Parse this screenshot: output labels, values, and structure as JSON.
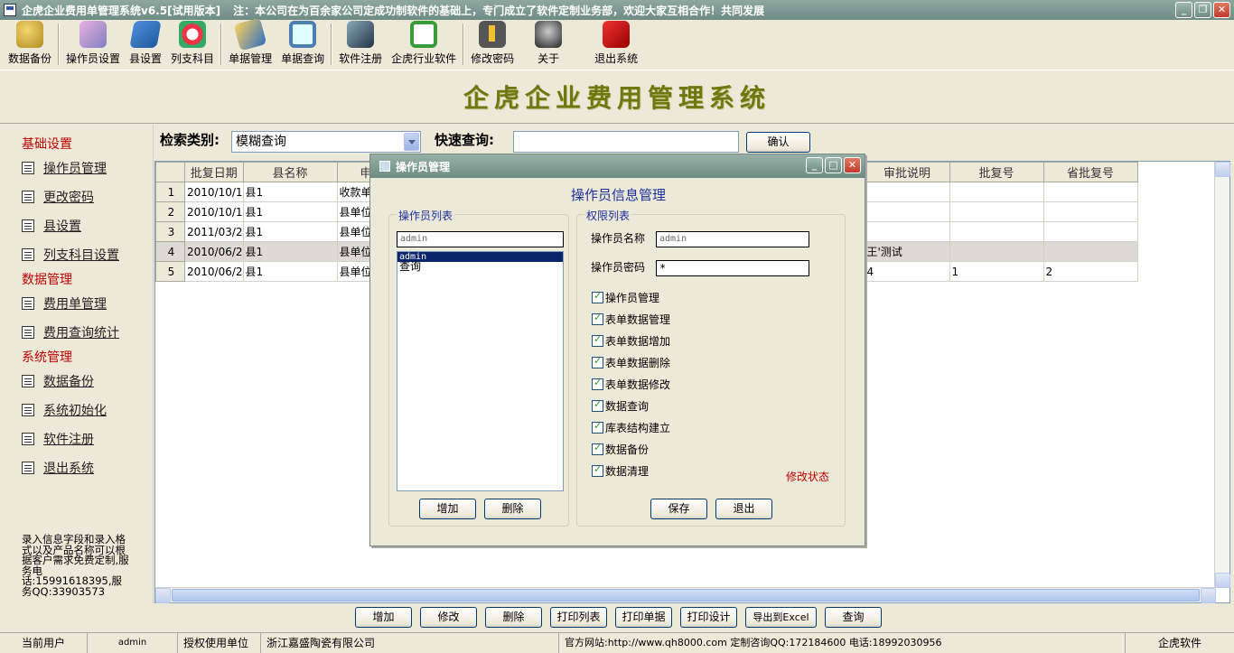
{
  "window": {
    "title": "企虎企业费用单管理系统v6.5[试用版本]",
    "notice": "注：本公司在为百余家公司定成功制软件的基础上，专门成立了软件定制业务部，欢迎大家互相合作！共同发展"
  },
  "toolbar": [
    {
      "label": "数据备份",
      "icon": "database-icon"
    },
    {
      "label": "操作员设置",
      "icon": "user-settings-icon"
    },
    {
      "label": "县设置",
      "icon": "county-icon"
    },
    {
      "label": "列支科目",
      "icon": "subject-icon"
    },
    {
      "label": "单据管理",
      "icon": "document-icon"
    },
    {
      "label": "单据查询",
      "icon": "magnifier-icon"
    },
    {
      "label": "软件注册",
      "icon": "register-icon"
    },
    {
      "label": "企虎行业软件",
      "icon": "refresh-icon"
    },
    {
      "label": "修改密码",
      "icon": "key-icon"
    },
    {
      "label": "关于",
      "icon": "about-icon"
    },
    {
      "label": "退出系统",
      "icon": "exit-icon"
    }
  ],
  "banner": "企虎企业费用管理系统",
  "sidebar": {
    "groups": [
      {
        "title": "基础设置",
        "items": [
          "操作员管理",
          "更改密码",
          "县设置",
          "列支科目设置"
        ]
      },
      {
        "title": "数据管理",
        "items": [
          "费用单管理",
          "费用查询统计"
        ]
      },
      {
        "title": "系统管理",
        "items": [
          "数据备份",
          "系统初始化",
          "软件注册",
          "退出系统"
        ]
      }
    ],
    "promo": "录入信息字段和录入格式以及产品名称可以根据客户需求免费定制,服务电话:15991618395,服务QQ:33903573"
  },
  "search": {
    "category_label": "检索类别:",
    "category_value": "模糊查询",
    "quick_label": "快速查询:",
    "quick_value": "",
    "confirm_label": "确认"
  },
  "grid": {
    "columns_left": [
      "批复日期",
      "县名称",
      "申"
    ],
    "columns_right": [
      "审批说明",
      "批复号",
      "省批复号"
    ],
    "rows": [
      {
        "n": "1",
        "date": "2010/10/1",
        "county": "县1",
        "app": "收款单",
        "note": "",
        "reply": "",
        "prov": ""
      },
      {
        "n": "2",
        "date": "2010/10/1",
        "county": "县1",
        "app": "县单位",
        "note": "",
        "reply": "",
        "prov": ""
      },
      {
        "n": "3",
        "date": "2011/03/2",
        "county": "县1",
        "app": "县单位",
        "note": "",
        "reply": "",
        "prov": ""
      },
      {
        "n": "4",
        "date": "2010/06/2",
        "county": "县1",
        "app": "县单位",
        "note": "王'测试",
        "reply": "",
        "prov": ""
      },
      {
        "n": "5",
        "date": "2010/06/2",
        "county": "县1",
        "app": "县单位",
        "note": "4",
        "reply": "1",
        "prov": "2"
      }
    ],
    "selected_row": 4
  },
  "bottom_buttons": [
    "增加",
    "修改",
    "删除",
    "打印列表",
    "打印单据",
    "打印设计",
    "导出到Excel",
    "查询"
  ],
  "statusbar": {
    "current_user_label": "当前用户",
    "current_user": "admin",
    "licensed_label": "授权使用单位",
    "licensed_to": "浙江嘉盛陶瓷有限公司",
    "website": "官方网站:http://www.qh8000.com 定制咨询QQ:172184600 电话:18992030956",
    "brand": "企虎软件"
  },
  "dialog": {
    "title": "操作员管理",
    "heading": "操作员信息管理",
    "list_legend": "操作员列表",
    "list_filter": "admin",
    "list_items": [
      "admin",
      "查询"
    ],
    "selected_item": "admin",
    "add_label": "增加",
    "delete_label": "删除",
    "perm_legend": "权限列表",
    "name_label": "操作员名称",
    "name_value": "admin",
    "pwd_label": "操作员密码",
    "pwd_value": "*",
    "permissions": [
      "操作员管理",
      "表单数据管理",
      "表单数据增加",
      "表单数据删除",
      "表单数据修改",
      "数据查询",
      "库表结构建立",
      "数据备份",
      "数据清理"
    ],
    "status_text": "修改状态",
    "save_label": "保存",
    "exit_label": "退出"
  }
}
